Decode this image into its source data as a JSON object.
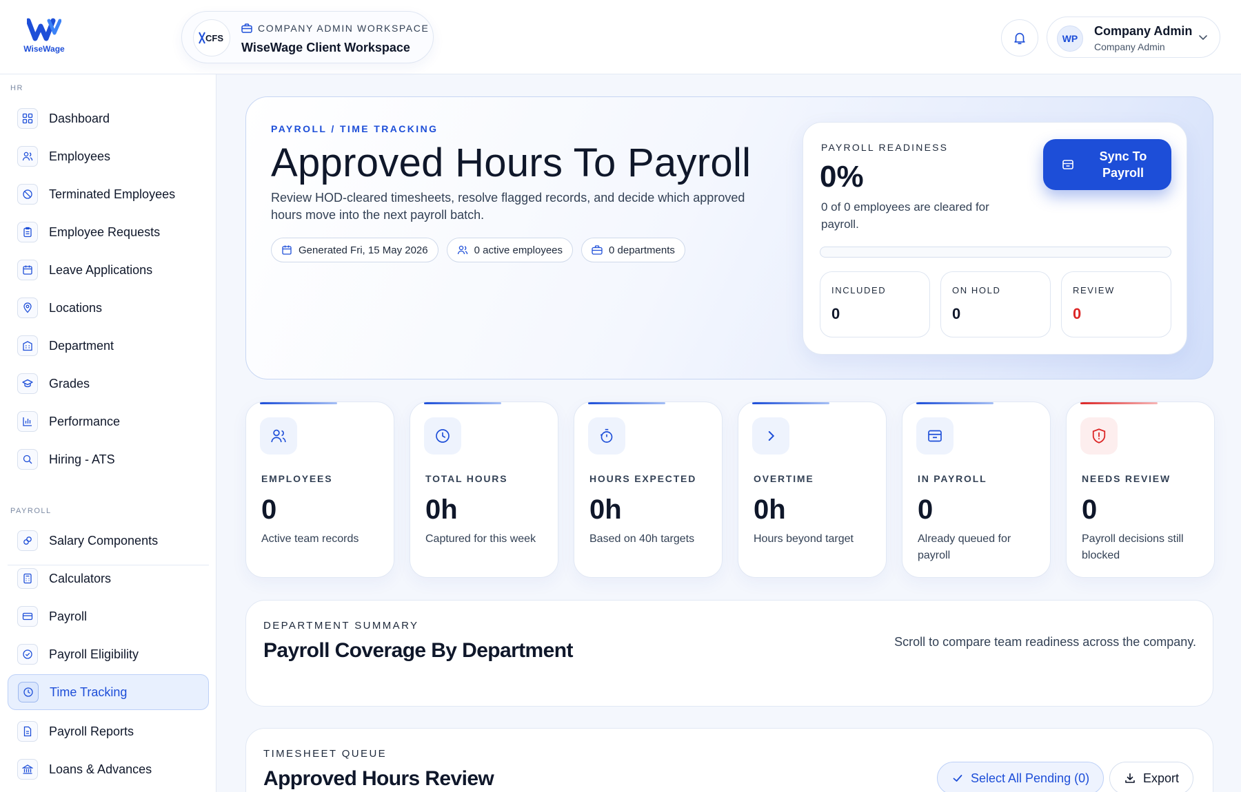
{
  "brand": {
    "name": "WiseWage"
  },
  "workspace": {
    "eyebrow": "COMPANY ADMIN WORKSPACE",
    "title": "WiseWage Client Workspace",
    "logo_text": "CFS"
  },
  "user": {
    "initials": "WP",
    "name": "Company Admin",
    "role": "Company Admin"
  },
  "sidebar": {
    "hr_label": "HR",
    "hr_items": [
      {
        "label": "Dashboard",
        "icon": "dashboard-icon"
      },
      {
        "label": "Employees",
        "icon": "employees-icon"
      },
      {
        "label": "Terminated Employees",
        "icon": "terminated-icon"
      },
      {
        "label": "Employee Requests",
        "icon": "requests-icon"
      },
      {
        "label": "Leave Applications",
        "icon": "calendar-icon"
      },
      {
        "label": "Locations",
        "icon": "location-icon"
      },
      {
        "label": "Department",
        "icon": "building-icon"
      },
      {
        "label": "Grades",
        "icon": "graduation-icon"
      },
      {
        "label": "Performance",
        "icon": "bar-chart-icon"
      },
      {
        "label": "Hiring - ATS",
        "icon": "search-icon"
      }
    ],
    "payroll_label": "PAYROLL",
    "payroll_items": [
      {
        "label": "Salary Components",
        "icon": "link-icon"
      },
      {
        "label": "Calculators",
        "icon": "calculator-icon"
      },
      {
        "label": "Payroll",
        "icon": "card-icon"
      },
      {
        "label": "Payroll Eligibility",
        "icon": "check-circle-icon"
      },
      {
        "label": "Time Tracking",
        "icon": "clock-icon",
        "active": true
      },
      {
        "label": "Payroll Reports",
        "icon": "report-icon"
      },
      {
        "label": "Loans & Advances",
        "icon": "bank-icon"
      }
    ]
  },
  "hero": {
    "eyebrow": "PAYROLL / TIME TRACKING",
    "title": "Approved Hours To Payroll",
    "description": "Review HOD-cleared timesheets, resolve flagged records, and decide which approved hours move into the next payroll batch.",
    "pills": [
      {
        "label": "Generated Fri, 15 May 2026",
        "icon": "calendar-icon"
      },
      {
        "label": "0 active employees",
        "icon": "users-icon"
      },
      {
        "label": "0 departments",
        "icon": "briefcase-icon"
      }
    ]
  },
  "readiness": {
    "eyebrow": "PAYROLL READINESS",
    "percent": "0%",
    "percent_value": 0,
    "description": "0 of 0 employees are cleared for payroll.",
    "sync_label": "Sync To Payroll",
    "stats": [
      {
        "label": "INCLUDED",
        "value": "0"
      },
      {
        "label": "ON HOLD",
        "value": "0"
      },
      {
        "label": "REVIEW",
        "value": "0"
      }
    ]
  },
  "stats": [
    {
      "label": "EMPLOYEES",
      "value": "0",
      "description": "Active team records",
      "icon": "users-icon"
    },
    {
      "label": "TOTAL HOURS",
      "value": "0h",
      "description": "Captured for this week",
      "icon": "clock-icon"
    },
    {
      "label": "HOURS EXPECTED",
      "value": "0h",
      "description": "Based on 40h targets",
      "icon": "timer-icon"
    },
    {
      "label": "OVERTIME",
      "value": "0h",
      "description": "Hours beyond target",
      "icon": "chevron-right-icon"
    },
    {
      "label": "IN PAYROLL",
      "value": "0",
      "description": "Already queued for payroll",
      "icon": "inbox-icon"
    },
    {
      "label": "NEEDS REVIEW",
      "value": "0",
      "description": "Payroll decisions still blocked",
      "icon": "shield-alert-icon"
    }
  ],
  "department_summary": {
    "eyebrow": "DEPARTMENT SUMMARY",
    "title": "Payroll Coverage By Department",
    "hint": "Scroll to compare team readiness across the company."
  },
  "timesheet_queue": {
    "eyebrow": "TIMESHEET QUEUE",
    "title": "Approved Hours Review",
    "select_all_label": "Select All Pending (0)",
    "export_label": "Export"
  },
  "colors": {
    "accent": "#1d4ed8",
    "danger": "#dc2626",
    "background": "#f4f7fd"
  }
}
